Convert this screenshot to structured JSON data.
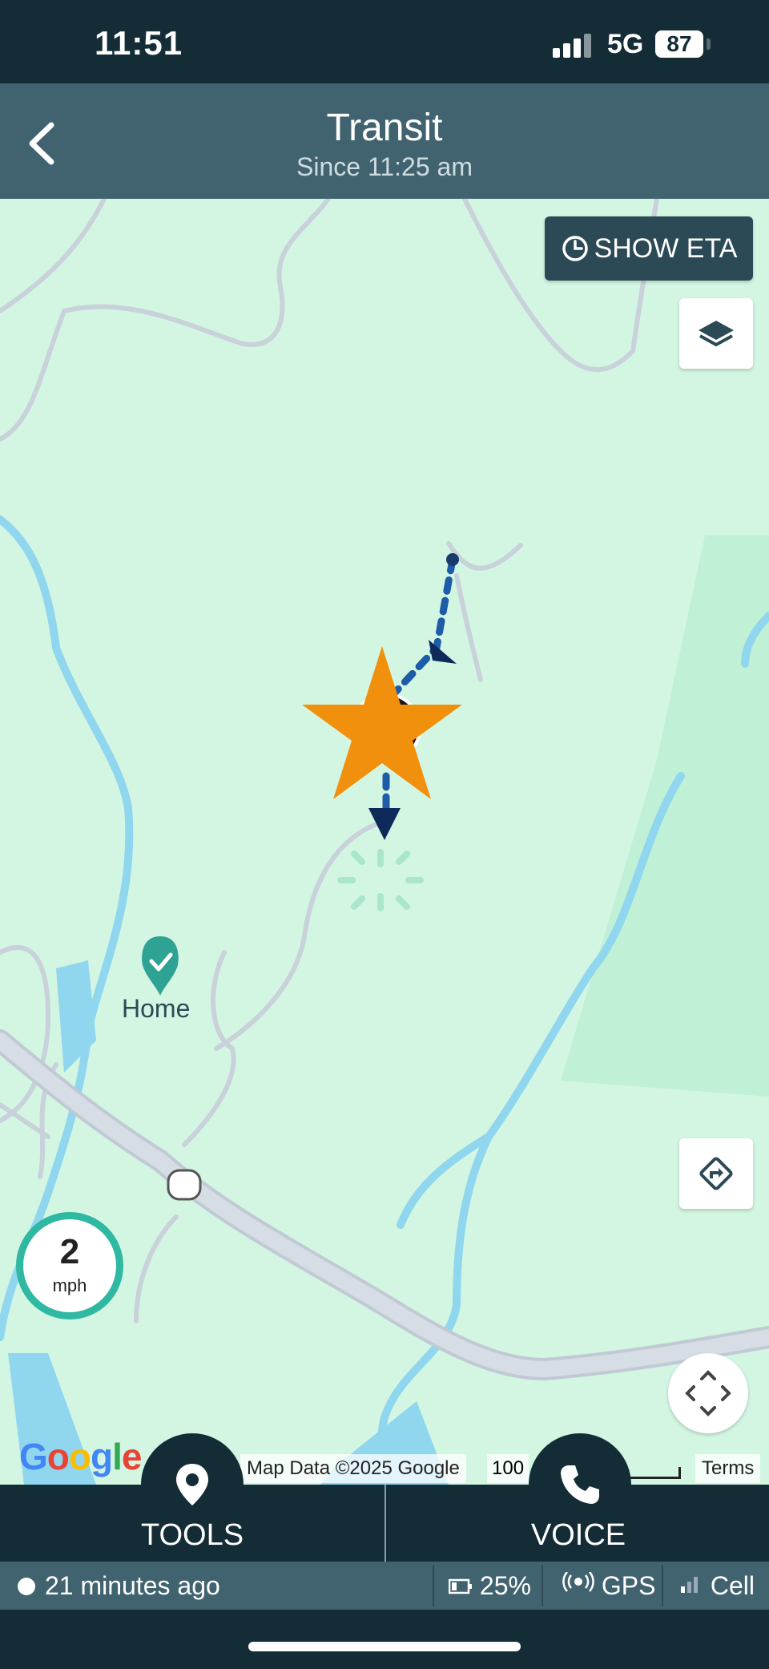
{
  "status_bar": {
    "time": "11:51",
    "network": "5G",
    "battery": "87"
  },
  "header": {
    "title": "Transit",
    "subtitle": "Since 11:25 am"
  },
  "map": {
    "eta_button": "SHOW ETA",
    "home_label": "Home",
    "speed": {
      "value": "2",
      "unit": "mph"
    },
    "google_logo": "Google",
    "attribution": "Map Data ©2025 Google",
    "scale_label": "100",
    "terms": "Terms",
    "colors": {
      "land": "#d3f6e3",
      "water": "#8fd6ee",
      "road": "#d3dbe3",
      "route": "#1e5ba8",
      "star": "#f0900c",
      "home_pin": "#2ea394"
    }
  },
  "bottom_bar": {
    "tools_label": "TOOLS",
    "voice_label": "VOICE"
  },
  "info_bar": {
    "last_update": "21 minutes ago",
    "battery": "25%",
    "gps": "GPS",
    "cell": "Cell"
  },
  "icons": [
    "back-icon",
    "clock-icon",
    "layers-icon",
    "directions-icon",
    "recenter-icon",
    "pin-icon",
    "phone-icon",
    "battery-icon",
    "gps-icon",
    "cell-signal-icon"
  ]
}
